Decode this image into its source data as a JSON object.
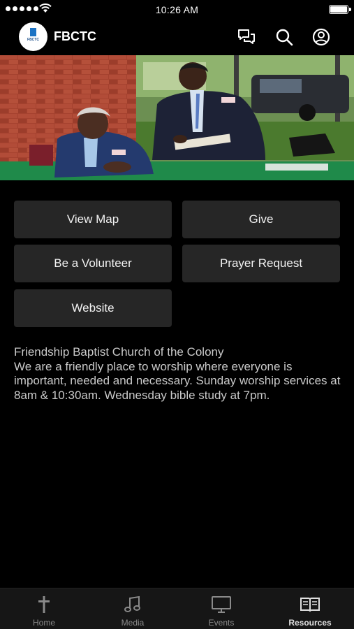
{
  "status_bar": {
    "time": "10:26 AM"
  },
  "header": {
    "app_title": "FBCTC",
    "logo_text": "FBCTC"
  },
  "buttons": {
    "view_map": "View Map",
    "give": "Give",
    "volunteer": "Be a Volunteer",
    "prayer_request": "Prayer Request",
    "website": "Website"
  },
  "description": {
    "line1": "Friendship Baptist Church of the Colony",
    "body": "We are a friendly place to worship where everyone is important, needed and necessary. Sunday worship services at 8am & 10:30am. Wednesday bible study at 7pm."
  },
  "tabs": [
    {
      "label": "Home",
      "icon": "cross-icon"
    },
    {
      "label": "Media",
      "icon": "music-note-icon"
    },
    {
      "label": "Events",
      "icon": "tv-icon"
    },
    {
      "label": "Resources",
      "icon": "book-icon",
      "active": true
    }
  ]
}
